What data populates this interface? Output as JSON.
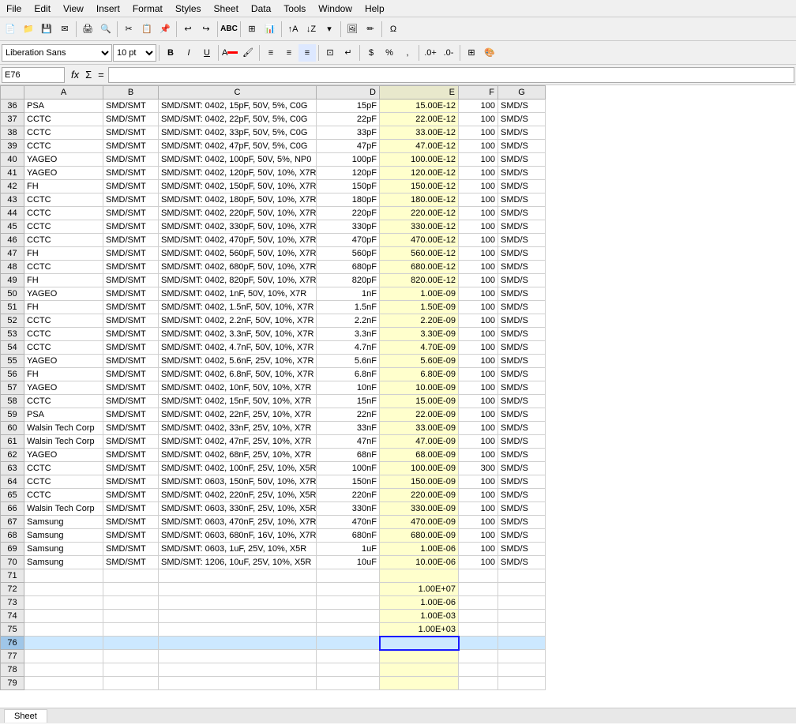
{
  "menubar": {
    "items": [
      "File",
      "Edit",
      "View",
      "Insert",
      "Format",
      "Styles",
      "Sheet",
      "Data",
      "Tools",
      "Window",
      "Help"
    ]
  },
  "top_tabs": [
    {
      "label": "Sheet",
      "active": true
    }
  ],
  "formulabar": {
    "cell_ref": "E76",
    "fx": "fx",
    "sigma": "Σ",
    "eq": "=",
    "value": ""
  },
  "font_name": "Liberation Sans",
  "font_size": "10 pt",
  "columns": [
    "",
    "A",
    "B",
    "C",
    "D",
    "E",
    "F"
  ],
  "rows": [
    {
      "num": "36",
      "a": "PSA",
      "b": "SMD/SMT",
      "c": "SMD/SMT: 0402, 15pF, 50V, 5%, C0G",
      "d": "15pF",
      "e": "15.00E-12",
      "f": "100",
      "g": "SMD/S"
    },
    {
      "num": "37",
      "a": "CCTC",
      "b": "SMD/SMT",
      "c": "SMD/SMT: 0402, 22pF, 50V, 5%, C0G",
      "d": "22pF",
      "e": "22.00E-12",
      "f": "100",
      "g": "SMD/S"
    },
    {
      "num": "38",
      "a": "CCTC",
      "b": "SMD/SMT",
      "c": "SMD/SMT: 0402, 33pF, 50V, 5%, C0G",
      "d": "33pF",
      "e": "33.00E-12",
      "f": "100",
      "g": "SMD/S"
    },
    {
      "num": "39",
      "a": "CCTC",
      "b": "SMD/SMT",
      "c": "SMD/SMT: 0402, 47pF, 50V, 5%, C0G",
      "d": "47pF",
      "e": "47.00E-12",
      "f": "100",
      "g": "SMD/S"
    },
    {
      "num": "40",
      "a": "YAGEO",
      "b": "SMD/SMT",
      "c": "SMD/SMT: 0402, 100pF, 50V, 5%, NP0",
      "d": "100pF",
      "e": "100.00E-12",
      "f": "100",
      "g": "SMD/S"
    },
    {
      "num": "41",
      "a": "YAGEO",
      "b": "SMD/SMT",
      "c": "SMD/SMT: 0402, 120pF, 50V, 10%, X7R",
      "d": "120pF",
      "e": "120.00E-12",
      "f": "100",
      "g": "SMD/S"
    },
    {
      "num": "42",
      "a": "FH",
      "b": "SMD/SMT",
      "c": "SMD/SMT: 0402, 150pF, 50V, 10%, X7R",
      "d": "150pF",
      "e": "150.00E-12",
      "f": "100",
      "g": "SMD/S"
    },
    {
      "num": "43",
      "a": "CCTC",
      "b": "SMD/SMT",
      "c": "SMD/SMT: 0402, 180pF, 50V, 10%, X7R",
      "d": "180pF",
      "e": "180.00E-12",
      "f": "100",
      "g": "SMD/S"
    },
    {
      "num": "44",
      "a": "CCTC",
      "b": "SMD/SMT",
      "c": "SMD/SMT: 0402, 220pF, 50V, 10%, X7R",
      "d": "220pF",
      "e": "220.00E-12",
      "f": "100",
      "g": "SMD/S"
    },
    {
      "num": "45",
      "a": "CCTC",
      "b": "SMD/SMT",
      "c": "SMD/SMT: 0402, 330pF, 50V, 10%, X7R",
      "d": "330pF",
      "e": "330.00E-12",
      "f": "100",
      "g": "SMD/S"
    },
    {
      "num": "46",
      "a": "CCTC",
      "b": "SMD/SMT",
      "c": "SMD/SMT: 0402, 470pF, 50V, 10%, X7R",
      "d": "470pF",
      "e": "470.00E-12",
      "f": "100",
      "g": "SMD/S"
    },
    {
      "num": "47",
      "a": "FH",
      "b": "SMD/SMT",
      "c": "SMD/SMT: 0402, 560pF, 50V, 10%, X7R",
      "d": "560pF",
      "e": "560.00E-12",
      "f": "100",
      "g": "SMD/S"
    },
    {
      "num": "48",
      "a": "CCTC",
      "b": "SMD/SMT",
      "c": "SMD/SMT: 0402, 680pF, 50V, 10%, X7R",
      "d": "680pF",
      "e": "680.00E-12",
      "f": "100",
      "g": "SMD/S"
    },
    {
      "num": "49",
      "a": "FH",
      "b": "SMD/SMT",
      "c": "SMD/SMT: 0402, 820pF, 50V, 10%, X7R",
      "d": "820pF",
      "e": "820.00E-12",
      "f": "100",
      "g": "SMD/S"
    },
    {
      "num": "50",
      "a": "YAGEO",
      "b": "SMD/SMT",
      "c": "SMD/SMT: 0402, 1nF, 50V, 10%, X7R",
      "d": "1nF",
      "e": "1.00E-09",
      "f": "100",
      "g": "SMD/S"
    },
    {
      "num": "51",
      "a": "FH",
      "b": "SMD/SMT",
      "c": "SMD/SMT: 0402, 1.5nF, 50V, 10%, X7R",
      "d": "1.5nF",
      "e": "1.50E-09",
      "f": "100",
      "g": "SMD/S"
    },
    {
      "num": "52",
      "a": "CCTC",
      "b": "SMD/SMT",
      "c": "SMD/SMT: 0402, 2.2nF, 50V, 10%, X7R",
      "d": "2.2nF",
      "e": "2.20E-09",
      "f": "100",
      "g": "SMD/S"
    },
    {
      "num": "53",
      "a": "CCTC",
      "b": "SMD/SMT",
      "c": "SMD/SMT: 0402, 3.3nF, 50V, 10%, X7R",
      "d": "3.3nF",
      "e": "3.30E-09",
      "f": "100",
      "g": "SMD/S"
    },
    {
      "num": "54",
      "a": "CCTC",
      "b": "SMD/SMT",
      "c": "SMD/SMT: 0402, 4.7nF, 50V, 10%, X7R",
      "d": "4.7nF",
      "e": "4.70E-09",
      "f": "100",
      "g": "SMD/S"
    },
    {
      "num": "55",
      "a": "YAGEO",
      "b": "SMD/SMT",
      "c": "SMD/SMT: 0402, 5.6nF, 25V, 10%, X7R",
      "d": "5.6nF",
      "e": "5.60E-09",
      "f": "100",
      "g": "SMD/S"
    },
    {
      "num": "56",
      "a": "FH",
      "b": "SMD/SMT",
      "c": "SMD/SMT: 0402, 6.8nF, 50V, 10%, X7R",
      "d": "6.8nF",
      "e": "6.80E-09",
      "f": "100",
      "g": "SMD/S"
    },
    {
      "num": "57",
      "a": "YAGEO",
      "b": "SMD/SMT",
      "c": "SMD/SMT: 0402, 10nF, 50V, 10%, X7R",
      "d": "10nF",
      "e": "10.00E-09",
      "f": "100",
      "g": "SMD/S"
    },
    {
      "num": "58",
      "a": "CCTC",
      "b": "SMD/SMT",
      "c": "SMD/SMT: 0402, 15nF, 50V, 10%, X7R",
      "d": "15nF",
      "e": "15.00E-09",
      "f": "100",
      "g": "SMD/S"
    },
    {
      "num": "59",
      "a": "PSA",
      "b": "SMD/SMT",
      "c": "SMD/SMT: 0402, 22nF, 25V, 10%, X7R",
      "d": "22nF",
      "e": "22.00E-09",
      "f": "100",
      "g": "SMD/S"
    },
    {
      "num": "60",
      "a": "Walsin Tech Corp",
      "b": "SMD/SMT",
      "c": "SMD/SMT: 0402, 33nF, 25V, 10%, X7R",
      "d": "33nF",
      "e": "33.00E-09",
      "f": "100",
      "g": "SMD/S"
    },
    {
      "num": "61",
      "a": "Walsin Tech Corp",
      "b": "SMD/SMT",
      "c": "SMD/SMT: 0402, 47nF, 25V, 10%, X7R",
      "d": "47nF",
      "e": "47.00E-09",
      "f": "100",
      "g": "SMD/S"
    },
    {
      "num": "62",
      "a": "YAGEO",
      "b": "SMD/SMT",
      "c": "SMD/SMT: 0402, 68nF, 25V, 10%, X7R",
      "d": "68nF",
      "e": "68.00E-09",
      "f": "100",
      "g": "SMD/S"
    },
    {
      "num": "63",
      "a": "CCTC",
      "b": "SMD/SMT",
      "c": "SMD/SMT: 0402, 100nF, 25V, 10%, X5R",
      "d": "100nF",
      "e": "100.00E-09",
      "f": "300",
      "g": "SMD/S"
    },
    {
      "num": "64",
      "a": "CCTC",
      "b": "SMD/SMT",
      "c": "SMD/SMT: 0603, 150nF, 50V, 10%, X7R",
      "d": "150nF",
      "e": "150.00E-09",
      "f": "100",
      "g": "SMD/S"
    },
    {
      "num": "65",
      "a": "CCTC",
      "b": "SMD/SMT",
      "c": "SMD/SMT: 0402, 220nF, 25V, 10%, X5R",
      "d": "220nF",
      "e": "220.00E-09",
      "f": "100",
      "g": "SMD/S"
    },
    {
      "num": "66",
      "a": "Walsin Tech Corp",
      "b": "SMD/SMT",
      "c": "SMD/SMT: 0603, 330nF, 25V, 10%, X5R",
      "d": "330nF",
      "e": "330.00E-09",
      "f": "100",
      "g": "SMD/S"
    },
    {
      "num": "67",
      "a": "Samsung",
      "b": "SMD/SMT",
      "c": "SMD/SMT: 0603, 470nF, 25V, 10%, X7R",
      "d": "470nF",
      "e": "470.00E-09",
      "f": "100",
      "g": "SMD/S"
    },
    {
      "num": "68",
      "a": "Samsung",
      "b": "SMD/SMT",
      "c": "SMD/SMT: 0603, 680nF, 16V, 10%, X7R",
      "d": "680nF",
      "e": "680.00E-09",
      "f": "100",
      "g": "SMD/S"
    },
    {
      "num": "69",
      "a": "Samsung",
      "b": "SMD/SMT",
      "c": "SMD/SMT: 0603, 1uF, 25V, 10%, X5R",
      "d": "1uF",
      "e": "1.00E-06",
      "f": "100",
      "g": "SMD/S"
    },
    {
      "num": "70",
      "a": "Samsung",
      "b": "SMD/SMT",
      "c": "SMD/SMT: 1206, 10uF, 25V, 10%, X5R",
      "d": "10uF",
      "e": "10.00E-06",
      "f": "100",
      "g": "SMD/S"
    },
    {
      "num": "71",
      "a": "",
      "b": "",
      "c": "",
      "d": "",
      "e": "",
      "f": "",
      "g": ""
    },
    {
      "num": "72",
      "a": "",
      "b": "",
      "c": "",
      "d": "",
      "e": "1.00E+07",
      "f": "",
      "g": ""
    },
    {
      "num": "73",
      "a": "",
      "b": "",
      "c": "",
      "d": "",
      "e": "1.00E-06",
      "f": "",
      "g": ""
    },
    {
      "num": "74",
      "a": "",
      "b": "",
      "c": "",
      "d": "",
      "e": "1.00E-03",
      "f": "",
      "g": ""
    },
    {
      "num": "75",
      "a": "",
      "b": "",
      "c": "",
      "d": "",
      "e": "1.00E+03",
      "f": "",
      "g": ""
    },
    {
      "num": "76",
      "a": "",
      "b": "",
      "c": "",
      "d": "",
      "e": "",
      "f": "",
      "g": "",
      "active": true
    },
    {
      "num": "77",
      "a": "",
      "b": "",
      "c": "",
      "d": "",
      "e": "",
      "f": "",
      "g": ""
    },
    {
      "num": "78",
      "a": "",
      "b": "",
      "c": "",
      "d": "",
      "e": "",
      "f": "",
      "g": ""
    },
    {
      "num": "79",
      "a": "",
      "b": "",
      "c": "",
      "d": "",
      "e": "",
      "f": "",
      "g": ""
    }
  ]
}
